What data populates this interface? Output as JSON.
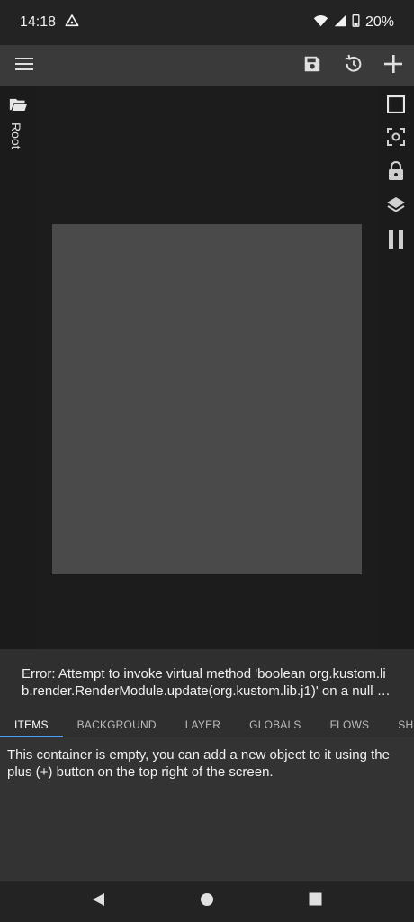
{
  "status_bar": {
    "time": "14:18",
    "battery": "20%",
    "icons": [
      "alert-triangle-icon",
      "wifi-icon",
      "cell-signal-icon",
      "battery-icon"
    ]
  },
  "app_bar": {
    "icons": [
      "menu-icon",
      "save-icon",
      "history-icon",
      "add-icon"
    ]
  },
  "left_rail": {
    "folder_icon": "folder-open-icon",
    "label": "Root"
  },
  "right_rail": {
    "icons": [
      "square-icon",
      "focus-icon",
      "lock-icon",
      "layers-icon",
      "pause-icon"
    ]
  },
  "error": {
    "text": "Error: Attempt to invoke virtual method 'boolean org.kustom.lib.render.RenderModule.update(org.kustom.lib.j1)' on a null object reference"
  },
  "tabs": [
    {
      "label": "ITEMS",
      "active": true
    },
    {
      "label": "BACKGROUND",
      "active": false
    },
    {
      "label": "LAYER",
      "active": false
    },
    {
      "label": "GLOBALS",
      "active": false
    },
    {
      "label": "FLOWS",
      "active": false
    },
    {
      "label": "SHORTCUTS",
      "active": false
    }
  ],
  "content": {
    "empty_message": "This container is empty, you can add a new object to it using the plus (+) button on the top right of the screen."
  },
  "nav_bar": {
    "icons": [
      "back-icon",
      "home-icon",
      "recents-icon"
    ]
  },
  "colors": {
    "accent": "#4d9ff5",
    "app_bar": "#3a3a3a",
    "canvas_preview": "#4a4a4a"
  }
}
